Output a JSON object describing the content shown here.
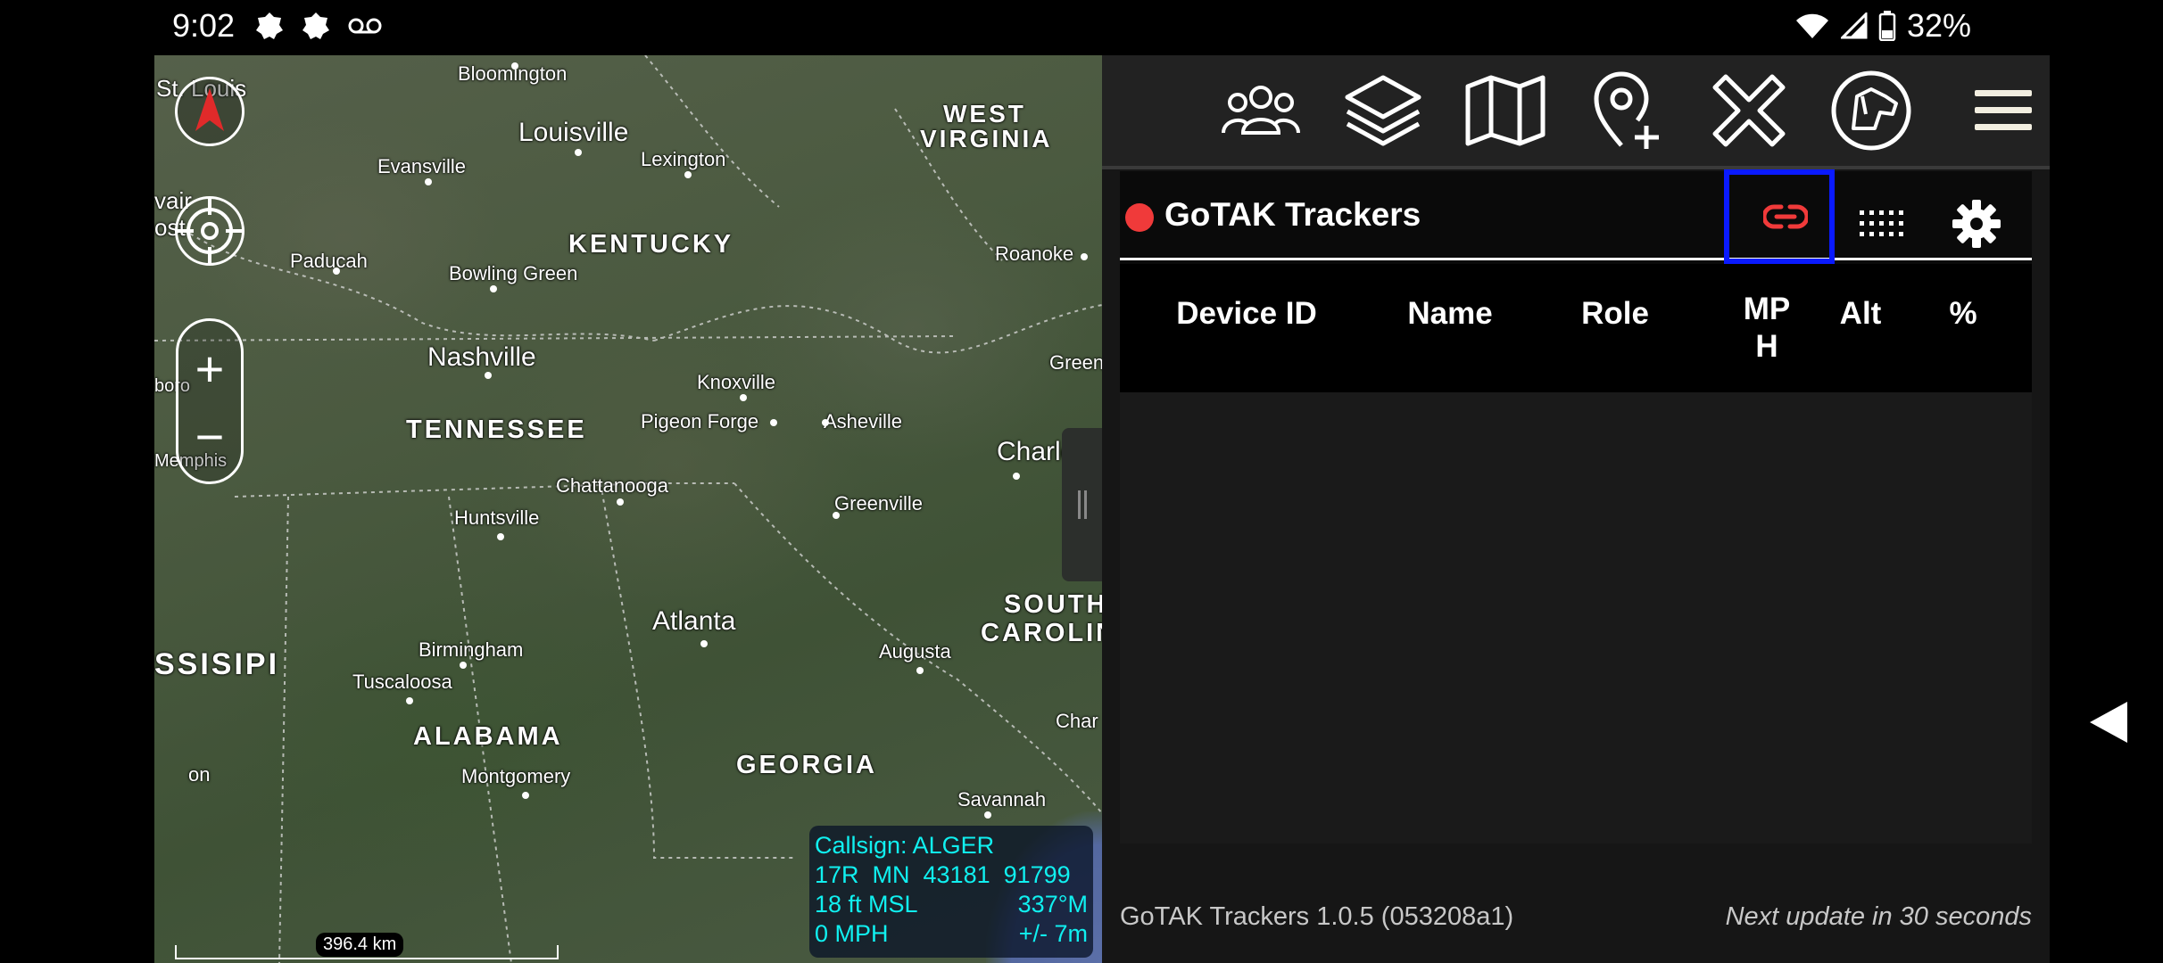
{
  "status_bar": {
    "time": "9:02",
    "battery_percent": "32%",
    "icons": [
      "notification-icon",
      "notification-icon",
      "voicemail-icon",
      "wifi-icon",
      "signal-icon",
      "battery-icon"
    ]
  },
  "map": {
    "scale_label": "396.4 km",
    "self_info": {
      "callsign": "Callsign: ALGER",
      "grid": "17R  MN  43181  91799",
      "altitude": "18 ft MSL",
      "heading": "337°M",
      "speed": "0 MPH",
      "accuracy": "+/- 7m"
    },
    "labels": {
      "st_louis": "St. Louis",
      "bloomington": "Bloomington",
      "louisville": "Louisville",
      "west_virginia_1": "WEST",
      "west_virginia_2": "VIRGINIA",
      "evansville": "Evansville",
      "lexington": "Lexington",
      "cairo_1": "vair",
      "cairo_2": "ost",
      "kentucky": "KENTUCKY",
      "paducah": "Paducah",
      "bowling_green": "Bowling Green",
      "roanoke": "Roanoke",
      "nashville": "Nashville",
      "knoxville": "Knoxville",
      "green": "Green",
      "boro": "boro",
      "tennessee": "TENNESSEE",
      "pigeon_forge": "Pigeon Forge",
      "asheville": "Asheville",
      "charlotte": "Charlotte",
      "memphis": "Memphis",
      "chattanooga": "Chattanooga",
      "huntsville": "Huntsville",
      "greenville": "Greenville",
      "atlanta": "Atlanta",
      "south_carolina_1": "SOUTH",
      "south_carolina_2": "CAROLIN",
      "mississippi": "SSISIPI",
      "birmingham": "Birmingham",
      "tuscaloosa": "Tuscaloosa",
      "augusta": "Augusta",
      "charleston": "Char",
      "alabama": "ALABAMA",
      "montgomery": "Montgomery",
      "georgia": "GEORGIA",
      "on": "on",
      "savannah": "Savannah"
    }
  },
  "plugin": {
    "title": "GoTAK Trackers",
    "status_color": "#f03a3a",
    "columns": [
      "Device ID",
      "Name",
      "Role",
      "MP\nH",
      "Alt",
      "%"
    ],
    "rows": [],
    "footer_version": "GoTAK Trackers 1.0.5 (053208a1)",
    "footer_next_update": "Next update in 30 seconds"
  },
  "toolbar": {
    "icons": [
      "contacts-icon",
      "layers-icon",
      "map-icon",
      "add-point-icon",
      "close-x-icon",
      "dog-tracker-icon",
      "menu-icon"
    ]
  },
  "colors": {
    "accent_highlight": "#0a1aff",
    "link_icon": "#f03a3a",
    "self_info_text": "#10f0f0"
  }
}
